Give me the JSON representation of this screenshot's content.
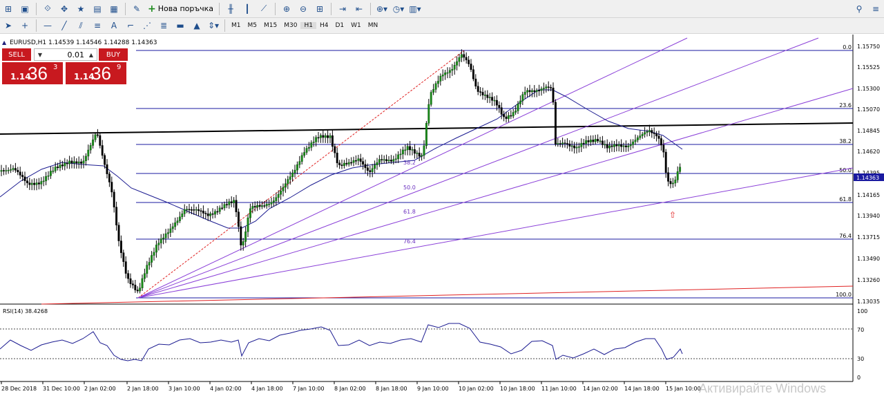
{
  "toolbar": {
    "new_order_label": "Нова поръчка",
    "timeframes": [
      "M1",
      "M5",
      "M15",
      "M30",
      "H1",
      "H4",
      "D1",
      "W1",
      "MN"
    ],
    "active_timeframe": "H1"
  },
  "chart": {
    "header": "EURUSD,H1  1.14539 1.14546 1.14288 1.14363",
    "current_price": "1.14363",
    "price_labels": [
      "1.15750",
      "1.15525",
      "1.15300",
      "1.15070",
      "1.14845",
      "1.14620",
      "1.14395",
      "1.14165",
      "1.13940",
      "1.13715",
      "1.13490",
      "1.13260",
      "1.13035"
    ],
    "time_labels": [
      "28 Dec 2018",
      "31 Dec 10:00",
      "2 Jan 02:00",
      "2 Jan 18:00",
      "3 Jan 10:00",
      "4 Jan 02:00",
      "4 Jan 18:00",
      "7 Jan 10:00",
      "8 Jan 02:00",
      "8 Jan 18:00",
      "9 Jan 10:00",
      "10 Jan 02:00",
      "10 Jan 18:00",
      "11 Jan 10:00",
      "14 Jan 02:00",
      "14 Jan 18:00",
      "15 Jan 10:00"
    ],
    "fib_right_labels": [
      "0.0",
      "23.6",
      "38.2",
      "50.0",
      "61.8",
      "76.4",
      "100.0"
    ],
    "fib_fan_labels": [
      "38.2",
      "50.0",
      "61.8",
      "76.4"
    ]
  },
  "rsi": {
    "label": "RSI(14) 38.4268",
    "scale": [
      "100",
      "70",
      "30",
      "0"
    ]
  },
  "trade_panel": {
    "sell_label": "SELL",
    "buy_label": "BUY",
    "lot": "0.01",
    "sell_prefix": "1.14",
    "sell_big": "36",
    "sell_sup": "3",
    "buy_prefix": "1.14",
    "buy_big": "36",
    "buy_sup": "9"
  },
  "watermark": "Активирайте Windows"
}
